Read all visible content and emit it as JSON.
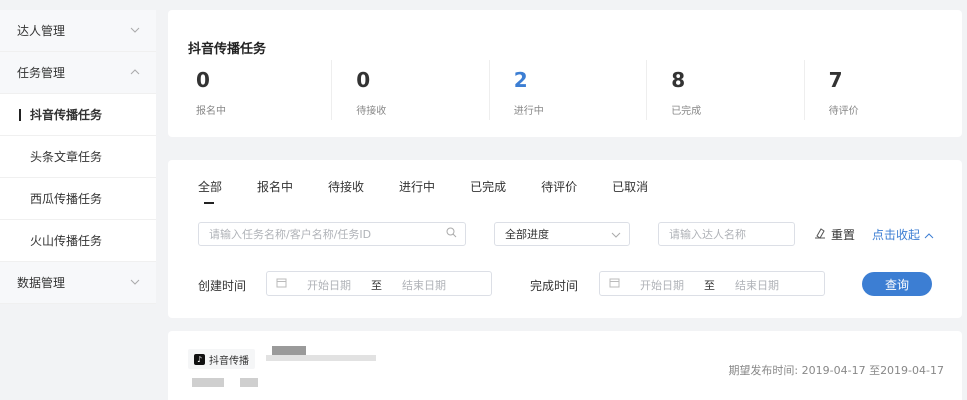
{
  "sidebar": {
    "items": [
      {
        "label": "达人管理",
        "chevron": "⌄"
      },
      {
        "label": "任务管理",
        "chevron": "⌃"
      },
      {
        "label": "抖音传播任务"
      },
      {
        "label": "头条文章任务"
      },
      {
        "label": "西瓜传播任务"
      },
      {
        "label": "火山传播任务"
      },
      {
        "label": "数据管理",
        "chevron": "⌄"
      }
    ]
  },
  "stats": {
    "title": "抖音传播任务",
    "items": [
      {
        "value": "0",
        "label": "报名中"
      },
      {
        "value": "0",
        "label": "待接收"
      },
      {
        "value": "2",
        "label": "进行中"
      },
      {
        "value": "8",
        "label": "已完成"
      },
      {
        "value": "7",
        "label": "待评价"
      }
    ]
  },
  "filters": {
    "tabs": [
      "全部",
      "报名中",
      "待接收",
      "进行中",
      "已完成",
      "待评价",
      "已取消"
    ],
    "search_placeholder": "请输入任务名称/客户名称/任务ID",
    "progress_select": "全部进度",
    "talent_placeholder": "请输入达人名称",
    "reset": "重置",
    "collapse": "点击收起",
    "created_label": "创建时间",
    "completed_label": "完成时间",
    "start_date": "开始日期",
    "end_date": "结束日期",
    "range_sep": "至",
    "query": "查询"
  },
  "task": {
    "platform": "抖音传播",
    "release_time": "期望发布时间: 2019-04-17 至2019-04-17"
  },
  "colors": {
    "accent": "#3c7ed3",
    "background": "#f2f3f5"
  }
}
